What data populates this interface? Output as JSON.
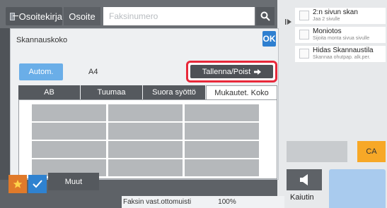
{
  "top_bar": {
    "address_book_label": "Osoitekirja",
    "address_label": "Osoite",
    "fax_placeholder": "Faksinumero"
  },
  "dialog": {
    "title": "Skannauskoko",
    "ok_label": "OK",
    "auto_label": "Autom.",
    "size_value": "A4",
    "save_remove_label": "Tallenna/Poist",
    "tabs": [
      {
        "label": "AB",
        "active": false
      },
      {
        "label": "Tuumaa",
        "active": false
      },
      {
        "label": "Suora syöttö",
        "active": false
      },
      {
        "label": "Mukautet. Koko",
        "active": true
      }
    ],
    "custom_size_slots": 12
  },
  "right_panel": {
    "options": [
      {
        "title": "2:n sivun skan",
        "subtitle": "Jaa 2 sivulle"
      },
      {
        "title": "Moniotos",
        "subtitle": "Sijoita monta sivua sivulle"
      },
      {
        "title": "Hidas Skannaustila",
        "subtitle": "Skannaa ohutpap. alk.per."
      }
    ],
    "ca_label": "CA",
    "speaker_label": "Kaiutin"
  },
  "bottom_bar": {
    "other_label": "Muut",
    "fax_memory_label": "Faksin vast.ottomuisti",
    "fax_memory_value": "100%"
  },
  "colors": {
    "accent_blue": "#2e7fd0",
    "highlight_red": "#e8283a",
    "ca_orange": "#f7a827",
    "star_orange": "#e07a2a"
  },
  "icons": {
    "search": "search-icon",
    "star": "star-icon",
    "check": "check-icon",
    "speaker": "speaker-icon",
    "arrow": "arrow-right-icon"
  }
}
